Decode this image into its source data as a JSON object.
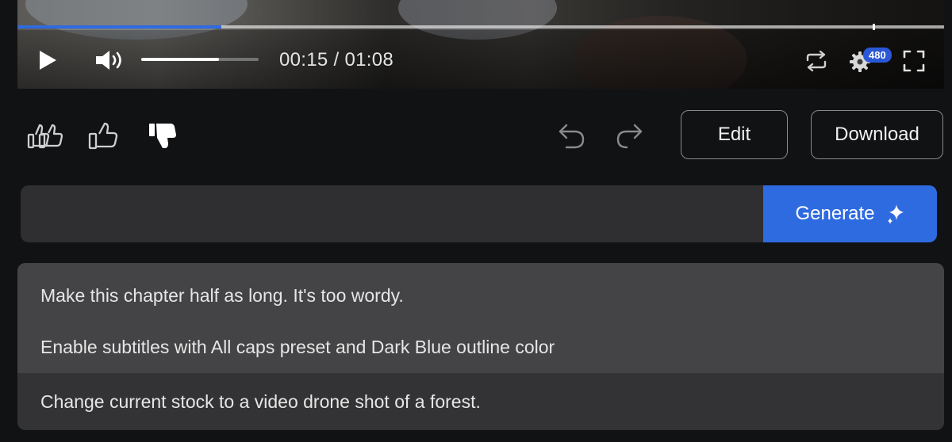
{
  "player": {
    "time_display": "00:15 / 01:08",
    "quality_badge": "480",
    "progress": 0.22,
    "volume": 0.66,
    "icons": [
      "play-icon",
      "volume-icon",
      "loop-icon",
      "settings-icon",
      "fullscreen-icon"
    ]
  },
  "feedback": {
    "icons": [
      "double-thumbs-up-icon",
      "thumbs-up-icon",
      "thumbs-down-icon",
      "undo-icon",
      "redo-icon"
    ]
  },
  "actions": {
    "edit_label": "Edit",
    "download_label": "Download"
  },
  "prompt": {
    "value": "",
    "generate_label": "Generate",
    "accent_color": "#2f6be0"
  },
  "suggestions": [
    {
      "text": "Make this chapter half as long. It's too wordy."
    },
    {
      "text": "Enable subtitles with All caps preset and Dark Blue outline color"
    },
    {
      "text": "Change current stock to a video drone shot of a forest."
    }
  ]
}
